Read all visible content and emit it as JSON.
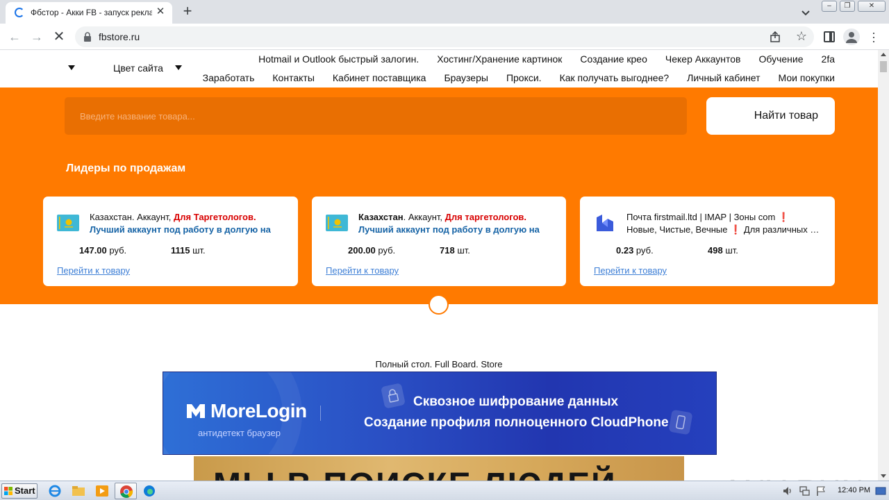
{
  "browser": {
    "tab_title": "Фбстор - Акки FB - запуск реклам",
    "tab_close": "✕",
    "new_tab": "+",
    "url": "fbstore.ru"
  },
  "window_controls": {
    "minimize": "–",
    "maximize": "❐",
    "close": "✕"
  },
  "nav": {
    "back": "←",
    "forward": "→",
    "stop": "✕"
  },
  "site": {
    "color_label": "Цвет сайта",
    "menu_row_1": [
      "Hotmail и Outlook быстрый залогин.",
      "Хостинг/Хранение картинок",
      "Создание крео",
      "Чекер Аккаунтов",
      "Обучение",
      "2fa"
    ],
    "menu_row_2": [
      "Заработать",
      "Контакты",
      "Кабинет поставщика",
      "Браузеры",
      "Прокси.",
      "Как получать выгоднее?",
      "Личный кабинет",
      "Мои покупки"
    ]
  },
  "search": {
    "placeholder": "Введите название товара...",
    "button_label": "Найти товар"
  },
  "leaders": {
    "title": "Лидеры по продажам",
    "cards": [
      {
        "line1_a": "Казахстан. Аккаунт, ",
        "line1_b": "Для Таргетологов.",
        "line2": "Лучший аккаунт под работу в долгую на",
        "price": "147.00",
        "price_unit": " руб.",
        "stock": "1115",
        "stock_unit": " шт.",
        "link": "Перейти к товару",
        "icon": "kazakhstan-flag-icon"
      },
      {
        "line1_a": "Казахстан",
        "line1_b": ". Аккаунт, ",
        "line1_c": "Для таргетологов.",
        "line2": "Лучший аккаунт под работу в долгую на",
        "price": "200.00",
        "price_unit": " руб.",
        "stock": "718",
        "stock_unit": " шт.",
        "link": "Перейти к товару",
        "icon": "kazakhstan-flag-icon"
      },
      {
        "line1": "Почта firstmail.ltd | IMAP | Зоны com ❗",
        "line2": "Новые, Чистые, Вечные ❗ Для различных сервисов",
        "price": "0.23",
        "price_unit": " руб.",
        "stock": "498",
        "stock_unit": " шт.",
        "link": "Перейти к товару",
        "icon": "firstmail-logo-icon"
      }
    ]
  },
  "board": {
    "title": "Полный стол. Full Board. Store"
  },
  "banner_morelogin": {
    "logo": "MoreLogin",
    "logo_sub": "антидетект браузер",
    "headline_1": "Сквозное шифрование данных",
    "headline_2": "Создание профиля полноценного CloudPhone"
  },
  "banner_second": {
    "text": "МЫ В ПОИСКЕ ЛЮДЕЙ"
  },
  "watermark": "ANY RUN",
  "taskbar": {
    "start": "Start",
    "clock": "12:40 PM"
  },
  "colors": {
    "hero_orange": "#ff7a00",
    "search_bg": "#e96f02",
    "link_blue": "#3e7fd6",
    "accent_red": "#d80000",
    "headline_blue": "#1764a6"
  }
}
